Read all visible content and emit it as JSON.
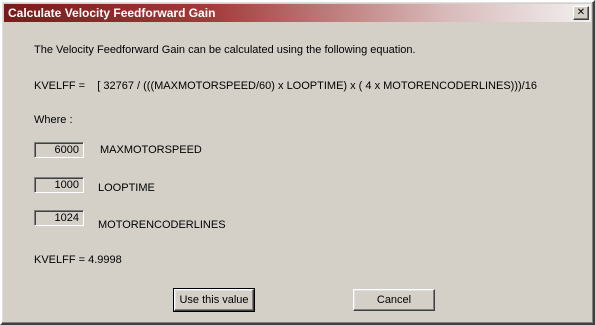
{
  "window": {
    "title": "Calculate Velocity Feedforward Gain",
    "close_glyph": "✕"
  },
  "content": {
    "intro": "The Velocity Feedforward Gain can be calculated using the following equation.",
    "equation": "KVELFF =    [ 32767 / (((MAXMOTORSPEED/60) x LOOPTIME) x ( 4 x MOTORENCODERLINES)))/16",
    "where_label": "Where :",
    "params": [
      {
        "value": "6000",
        "label": "MAXMOTORSPEED"
      },
      {
        "value": "1000",
        "label": "LOOPTIME"
      },
      {
        "value": "1024",
        "label": "MOTORENCODERLINES"
      }
    ],
    "result": "KVELFF = 4.9998"
  },
  "buttons": {
    "use": "Use this value",
    "cancel": "Cancel"
  },
  "colors": {
    "titlebar_start": "#7a1a1a",
    "face": "#d4d0c8"
  },
  "icons": {
    "close": "close-icon"
  }
}
